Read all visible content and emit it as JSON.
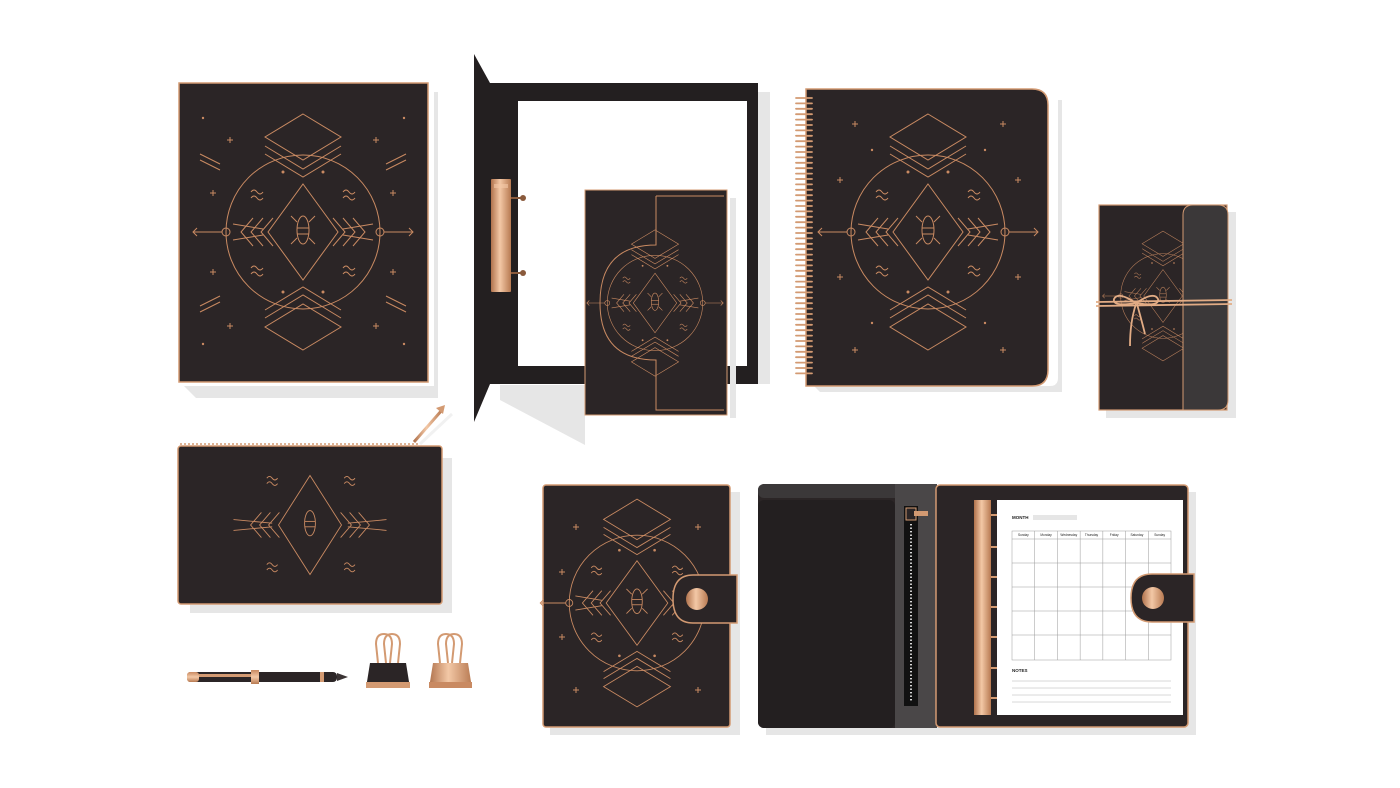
{
  "colors": {
    "background": "#ffffff",
    "cover": "#2b2526",
    "cover_dark": "#1f1a1b",
    "copper": "#d39a72",
    "copper_light": "#f0c2a0",
    "copper_dark": "#b0724c",
    "shadow": "#e6e6e6",
    "grey_flap": "#3b3839"
  },
  "items": [
    {
      "name": "notebook-cover",
      "icon": "geometric-emblem-icon"
    },
    {
      "name": "ring-binder-folder",
      "icon": "ring-binder-icon"
    },
    {
      "name": "spiral-notebook",
      "icon": "spiral-binding-icon"
    },
    {
      "name": "string-tie-journal",
      "icon": "string-bow-icon"
    },
    {
      "name": "zipper-pouch",
      "icon": "zipper-pull-icon"
    },
    {
      "name": "fountain-pen",
      "icon": "pen-icon"
    },
    {
      "name": "binder-clip-black",
      "icon": "binder-clip-icon"
    },
    {
      "name": "binder-clip-copper",
      "icon": "binder-clip-icon"
    },
    {
      "name": "snap-closure-planner",
      "icon": "snap-button-icon"
    },
    {
      "name": "open-planner",
      "icon": "calendar-grid-icon"
    }
  ],
  "planner": {
    "month_label": "MONTH",
    "days": [
      "Sunday",
      "Monday",
      "Wednesday",
      "Thursday",
      "Friday",
      "Saturday",
      "Sunday"
    ],
    "notes_label": "NOTES"
  }
}
